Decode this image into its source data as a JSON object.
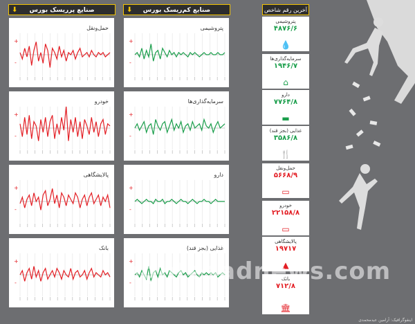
{
  "headers": {
    "risky": "صنایع پرریسک بورس",
    "low_risk": "صنایع کم‌ریسک بورس",
    "latest": "آخرین رقم شاخص"
  },
  "colors": {
    "red": "#e31e24",
    "green": "#1a9e4b",
    "bg": "#6d6e71",
    "dark": "#2d2d2d",
    "yellow": "#f2c200"
  },
  "chart_data": [
    {
      "type": "line",
      "title": "حمل‌ونقل",
      "color": "#e31e24",
      "ylim": [
        -1,
        1
      ],
      "values": [
        0.1,
        -0.2,
        0.3,
        -0.1,
        0.4,
        -0.5,
        0.2,
        0.6,
        -0.3,
        0.1,
        -0.4,
        0.5,
        0.2,
        -0.6,
        0.3,
        0.1,
        -0.2,
        0.4,
        -0.1,
        0.2,
        -0.3,
        0.1,
        0.0,
        0.2,
        -0.2,
        0.1,
        0.3,
        -0.1,
        0.0,
        0.1,
        -0.1,
        0.2,
        0.0,
        -0.1,
        0.1,
        0.0,
        0.1,
        -0.1,
        0.0,
        0.1
      ]
    },
    {
      "type": "line",
      "title": "پتروشیمی",
      "color": "#1a9e4b",
      "ylim": [
        -1,
        1
      ],
      "values": [
        0.0,
        0.1,
        -0.1,
        0.3,
        -0.2,
        0.2,
        -0.1,
        0.5,
        -0.3,
        0.1,
        0.2,
        -0.2,
        0.3,
        0.1,
        -0.1,
        0.2,
        0.0,
        0.1,
        -0.1,
        0.1,
        0.0,
        0.1,
        0.0,
        -0.1,
        0.1,
        0.0,
        0.1,
        0.0,
        -0.1,
        0.0,
        0.1,
        0.0,
        0.0,
        0.1,
        0.0,
        0.0,
        0.1,
        0.0,
        0.0,
        0.1
      ]
    },
    {
      "type": "line",
      "title": "خودرو",
      "color": "#e31e24",
      "ylim": [
        -1,
        1
      ],
      "values": [
        0.2,
        -0.4,
        0.5,
        -0.3,
        0.6,
        -0.5,
        0.3,
        0.1,
        -0.6,
        0.4,
        -0.2,
        0.5,
        -0.4,
        0.3,
        0.6,
        -0.5,
        0.2,
        -0.3,
        0.5,
        -0.1,
        1.0,
        -0.6,
        0.4,
        -0.2,
        0.5,
        -0.4,
        0.3,
        -0.5,
        0.4,
        0.1,
        -0.3,
        0.5,
        -0.2,
        0.3,
        -0.4,
        0.2,
        0.4,
        -0.3,
        0.2,
        0.1
      ]
    },
    {
      "type": "line",
      "title": "سرمایه‌گذاری‌ها",
      "color": "#1a9e4b",
      "ylim": [
        -1,
        1
      ],
      "values": [
        0.0,
        0.2,
        -0.1,
        0.1,
        0.3,
        -0.2,
        0.1,
        0.2,
        -0.3,
        0.4,
        0.1,
        -0.1,
        0.2,
        0.3,
        -0.2,
        0.1,
        0.4,
        -0.1,
        0.2,
        0.0,
        0.3,
        -0.2,
        0.1,
        0.2,
        -0.1,
        0.3,
        0.0,
        0.1,
        0.2,
        -0.1,
        0.4,
        0.1,
        0.0,
        0.2,
        -0.2,
        0.1,
        0.3,
        0.0,
        0.1,
        0.2
      ]
    },
    {
      "type": "line",
      "title": "پالایشگاهی",
      "color": "#e31e24",
      "ylim": [
        -1,
        1
      ],
      "values": [
        -0.1,
        0.2,
        -0.3,
        0.1,
        0.3,
        -0.2,
        0.4,
        0.0,
        0.2,
        -0.4,
        0.3,
        0.5,
        -0.2,
        0.1,
        0.6,
        -0.1,
        0.3,
        -0.3,
        0.4,
        0.2,
        -0.2,
        0.3,
        0.1,
        -0.1,
        0.4,
        0.2,
        -0.3,
        0.1,
        0.3,
        -0.2,
        0.2,
        0.4,
        -0.1,
        0.1,
        0.3,
        -0.2,
        0.2,
        0.0,
        0.3,
        -0.3
      ]
    },
    {
      "type": "line",
      "title": "دارو",
      "color": "#1a9e4b",
      "ylim": [
        -1,
        1
      ],
      "values": [
        0.0,
        0.1,
        0.0,
        -0.1,
        0.0,
        0.1,
        0.0,
        0.0,
        -0.1,
        0.1,
        0.0,
        0.0,
        0.1,
        -0.1,
        0.0,
        0.0,
        0.1,
        0.0,
        -0.1,
        0.0,
        0.1,
        0.0,
        0.0,
        -0.1,
        0.0,
        0.1,
        0.0,
        -0.1,
        0.0,
        0.0,
        0.1,
        0.0,
        0.0,
        -0.1,
        0.0,
        0.1,
        0.0,
        0.0,
        0.0,
        0.0
      ]
    },
    {
      "type": "line",
      "title": "بانک",
      "color": "#e31e24",
      "ylim": [
        -1,
        1
      ],
      "values": [
        0.0,
        0.2,
        -0.3,
        0.1,
        0.3,
        -0.2,
        0.4,
        -0.1,
        0.2,
        -0.3,
        0.1,
        0.3,
        -0.2,
        0.0,
        0.2,
        -0.1,
        0.3,
        0.1,
        -0.2,
        0.2,
        0.0,
        -0.1,
        0.3,
        -0.2,
        0.1,
        0.2,
        -0.1,
        0.0,
        0.2,
        -0.2,
        0.1,
        0.3,
        -0.1,
        0.1,
        0.0,
        -0.1,
        0.2,
        0.0,
        0.1,
        -0.1
      ]
    },
    {
      "type": "line",
      "title": "غذایی (بجز قند)",
      "color": "#1a9e4b",
      "ylim": [
        -1,
        1
      ],
      "values": [
        0.0,
        0.1,
        -0.1,
        0.2,
        0.0,
        -0.2,
        0.4,
        -0.3,
        0.1,
        0.2,
        -0.1,
        0.3,
        0.0,
        0.1,
        -0.1,
        0.2,
        0.1,
        0.0,
        -0.1,
        0.1,
        0.2,
        0.0,
        0.1,
        -0.1,
        0.0,
        0.1,
        0.2,
        0.0,
        -0.1,
        0.1,
        0.0,
        0.1,
        0.0,
        0.1,
        0.0,
        0.1,
        -0.1,
        0.0,
        0.1,
        0.0
      ]
    }
  ],
  "indices": [
    {
      "name": "پتروشیمی",
      "value": "۴۸۷۶/۶",
      "color": "#1a9e4b",
      "icon": "drop-icon",
      "glyph": "💧"
    },
    {
      "name": "سرمایه‌گذاری‌ها",
      "value": "۱۹۴۶/۷",
      "color": "#1a9e4b",
      "icon": "house-icon",
      "glyph": "⌂"
    },
    {
      "name": "دارو",
      "value": "۷۷۶۴/۸",
      "color": "#1a9e4b",
      "icon": "pill-icon",
      "glyph": "▬"
    },
    {
      "name": "غذایی (بجز قند)",
      "value": "۳۵۸۶/۸",
      "color": "#1a9e4b",
      "icon": "cutlery-icon",
      "glyph": "🍴"
    },
    {
      "name": "حمل‌ونقل",
      "value": "۵۶۶۸/۹",
      "color": "#e31e24",
      "icon": "truck-icon",
      "glyph": "▭"
    },
    {
      "name": "خودرو",
      "value": "۲۲۱۵۸/۸",
      "color": "#e31e24",
      "icon": "car-icon",
      "glyph": "▭"
    },
    {
      "name": "پالایشگاهی",
      "value": "۱۹۷۱۷",
      "color": "#e31e24",
      "icon": "refinery-icon",
      "glyph": "▲"
    },
    {
      "name": "بانک",
      "value": "۷۱۲/۸",
      "color": "#e31e24",
      "icon": "bank-icon",
      "glyph": "🏛"
    }
  ],
  "watermark": "eghtesadnews.com",
  "credit": "اینفوگرافیک: آرامین عبدمحمدی"
}
